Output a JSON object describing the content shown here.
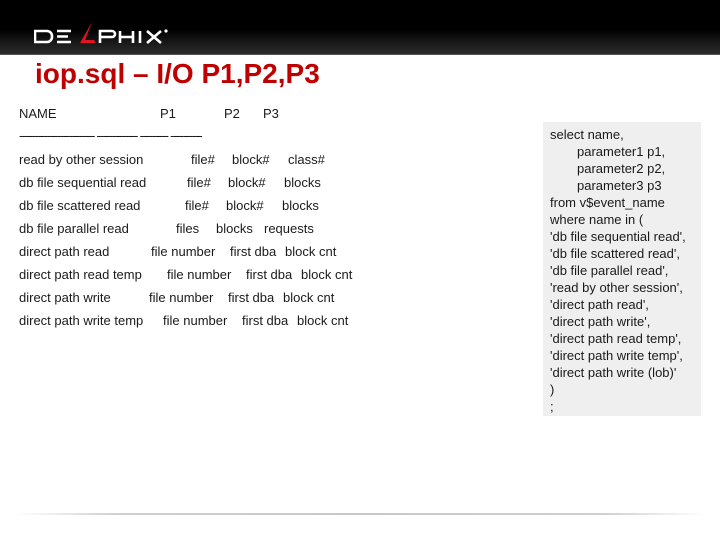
{
  "header": {
    "logo_text": "DELPHIX",
    "logo_accent_color": "#e0141e",
    "brand_color": "#c00000"
  },
  "title": "iop.sql – I/O P1,P2,P3",
  "listing": {
    "header": {
      "name": "NAME",
      "p1": "P1",
      "p2": "P2",
      "p3": "P3"
    },
    "separator": "------------------------ ------------- --------- ----------",
    "rows": [
      {
        "name": "read by other session",
        "p1": "file#",
        "p2": "block#",
        "p3": "class#"
      },
      {
        "name": "db file sequential read",
        "p1": "file#",
        "p2": "block#",
        "p3": "blocks"
      },
      {
        "name": "db file scattered read",
        "p1": "file#",
        "p2": "block#",
        "p3": "blocks"
      },
      {
        "name": "db file parallel read",
        "p1": "files",
        "p2": "blocks",
        "p3": "requests"
      },
      {
        "name": "direct path read",
        "p1": "file number",
        "p2": "first dba",
        "p3": "block cnt"
      },
      {
        "name": "direct path read temp",
        "p1": "file number",
        "p2": "first dba",
        "p3": "block cnt"
      },
      {
        "name": "direct path write",
        "p1": "file number",
        "p2": "first dba",
        "p3": "block cnt"
      },
      {
        "name": "direct path write temp",
        "p1": "file number",
        "p2": "first dba",
        "p3": "block cnt"
      }
    ]
  },
  "sql": {
    "lines": [
      "select name,",
      "        parameter1 p1,",
      "        parameter2 p2,",
      "        parameter3 p3",
      "from v$event_name",
      "where name in (",
      "'db file sequential read',",
      "'db file scattered read',",
      "'db file parallel read',",
      "'read by other session',",
      "'direct path read',",
      "'direct path write',",
      "'direct path read temp',",
      "'direct path write temp',",
      "'direct path write (lob)'",
      ")",
      ";"
    ]
  }
}
